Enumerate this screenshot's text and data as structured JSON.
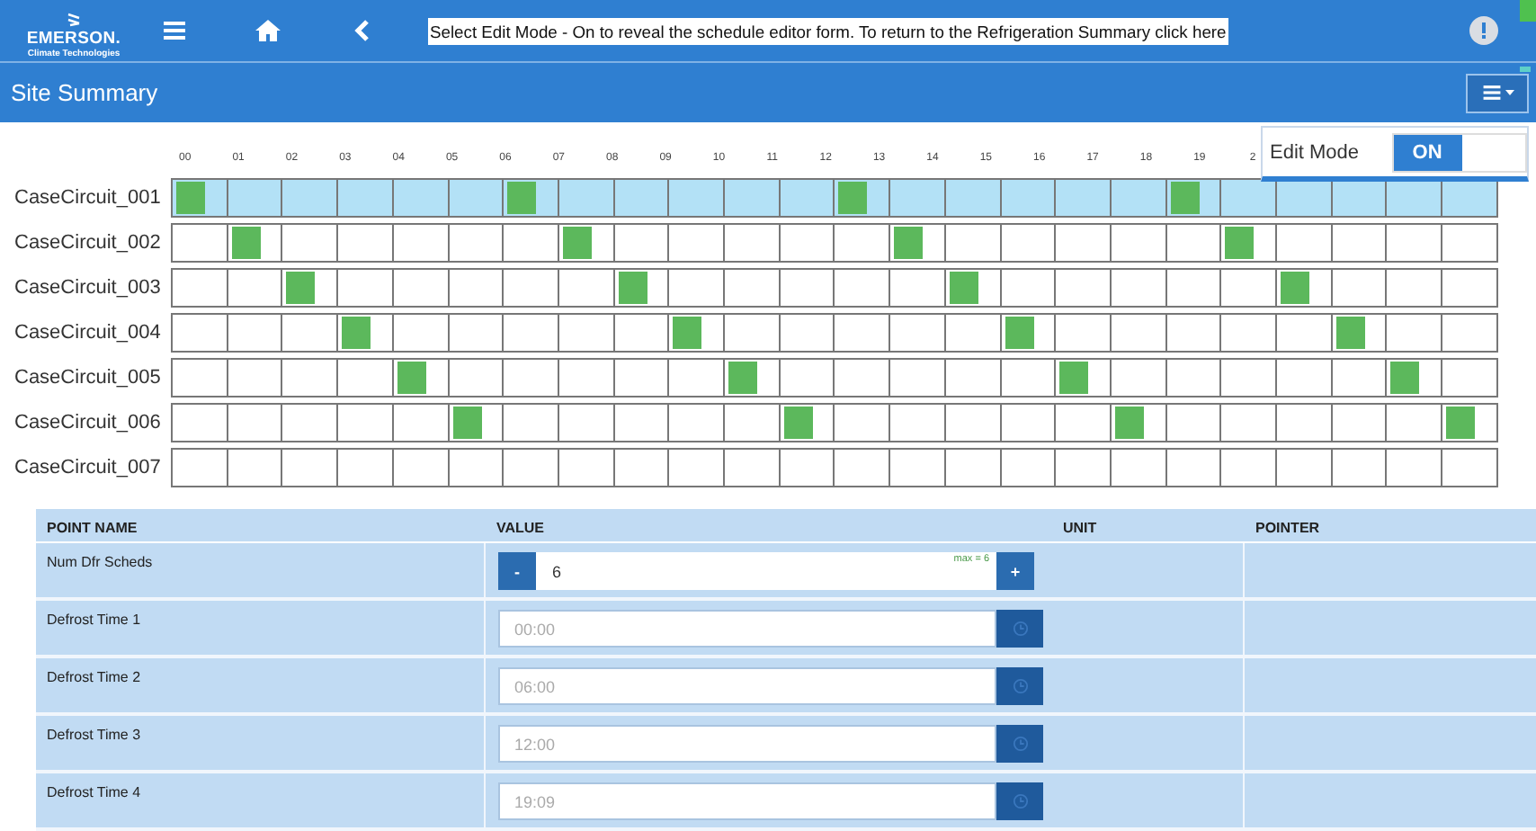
{
  "header": {
    "logo": {
      "name": "EMERSON.",
      "tagline": "Climate Technologies"
    },
    "message": "Select Edit Mode - On to reveal the schedule editor form. To return to the Refrigeration Summary click here"
  },
  "page_title": "Site Summary",
  "edit_mode": {
    "label": "Edit Mode",
    "state": "ON",
    "on": true
  },
  "schedule": {
    "hours": [
      "00",
      "01",
      "02",
      "03",
      "04",
      "05",
      "06",
      "07",
      "08",
      "09",
      "10",
      "11",
      "12",
      "13",
      "14",
      "15",
      "16",
      "17",
      "18",
      "19",
      "2"
    ],
    "rows": [
      {
        "name": "CaseCircuit_001",
        "selected": true,
        "slots": [
          true,
          false,
          false,
          false,
          false,
          false,
          true,
          false,
          false,
          false,
          false,
          false,
          true,
          false,
          false,
          false,
          false,
          false,
          true,
          false,
          false,
          false,
          false,
          false
        ]
      },
      {
        "name": "CaseCircuit_002",
        "selected": false,
        "slots": [
          false,
          true,
          false,
          false,
          false,
          false,
          false,
          true,
          false,
          false,
          false,
          false,
          false,
          true,
          false,
          false,
          false,
          false,
          false,
          true,
          false,
          false,
          false,
          false
        ]
      },
      {
        "name": "CaseCircuit_003",
        "selected": false,
        "slots": [
          false,
          false,
          true,
          false,
          false,
          false,
          false,
          false,
          true,
          false,
          false,
          false,
          false,
          false,
          true,
          false,
          false,
          false,
          false,
          false,
          true,
          false,
          false,
          false
        ]
      },
      {
        "name": "CaseCircuit_004",
        "selected": false,
        "slots": [
          false,
          false,
          false,
          true,
          false,
          false,
          false,
          false,
          false,
          true,
          false,
          false,
          false,
          false,
          false,
          true,
          false,
          false,
          false,
          false,
          false,
          true,
          false,
          false
        ]
      },
      {
        "name": "CaseCircuit_005",
        "selected": false,
        "slots": [
          false,
          false,
          false,
          false,
          true,
          false,
          false,
          false,
          false,
          false,
          true,
          false,
          false,
          false,
          false,
          false,
          true,
          false,
          false,
          false,
          false,
          false,
          true,
          false
        ]
      },
      {
        "name": "CaseCircuit_006",
        "selected": false,
        "slots": [
          false,
          false,
          false,
          false,
          false,
          true,
          false,
          false,
          false,
          false,
          false,
          true,
          false,
          false,
          false,
          false,
          false,
          true,
          false,
          false,
          false,
          false,
          false,
          true
        ]
      },
      {
        "name": "CaseCircuit_007",
        "selected": false,
        "slots": [
          false,
          false,
          false,
          false,
          false,
          false,
          false,
          false,
          false,
          false,
          false,
          false,
          false,
          false,
          false,
          false,
          false,
          false,
          false,
          false,
          false,
          false,
          false,
          false
        ]
      }
    ]
  },
  "points": {
    "columns": [
      "POINT NAME",
      "VALUE",
      "UNIT",
      "POINTER"
    ],
    "rows": [
      {
        "kind": "stepper",
        "name": "Num Dfr Scheds",
        "value": "6",
        "minus": "-",
        "plus": "+",
        "hint": "max = 6"
      },
      {
        "kind": "time",
        "name": "Defrost Time 1",
        "placeholder": "00:00"
      },
      {
        "kind": "time",
        "name": "Defrost Time 2",
        "placeholder": "06:00"
      },
      {
        "kind": "time",
        "name": "Defrost Time 3",
        "placeholder": "12:00"
      },
      {
        "kind": "time",
        "name": "Defrost Time 4",
        "placeholder": "19:09"
      }
    ]
  }
}
